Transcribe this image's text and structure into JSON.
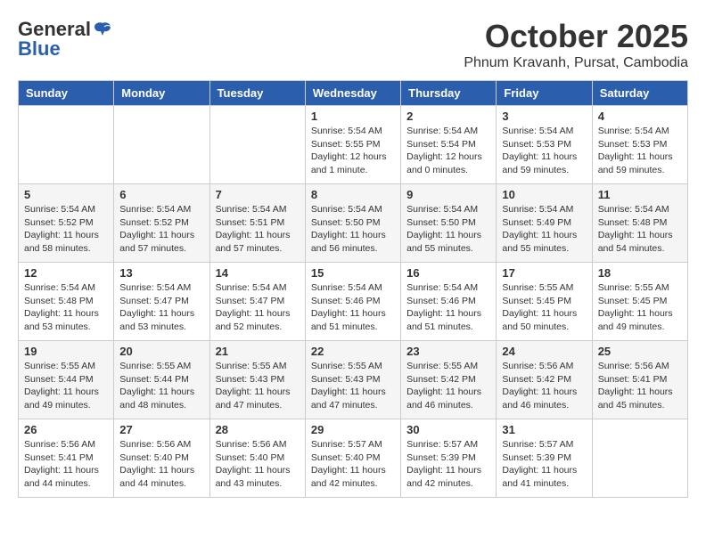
{
  "header": {
    "logo_general": "General",
    "logo_blue": "Blue",
    "month": "October 2025",
    "location": "Phnum Kravanh, Pursat, Cambodia"
  },
  "days_of_week": [
    "Sunday",
    "Monday",
    "Tuesday",
    "Wednesday",
    "Thursday",
    "Friday",
    "Saturday"
  ],
  "weeks": [
    [
      {
        "day": "",
        "info": ""
      },
      {
        "day": "",
        "info": ""
      },
      {
        "day": "",
        "info": ""
      },
      {
        "day": "1",
        "info": "Sunrise: 5:54 AM\nSunset: 5:55 PM\nDaylight: 12 hours\nand 1 minute."
      },
      {
        "day": "2",
        "info": "Sunrise: 5:54 AM\nSunset: 5:54 PM\nDaylight: 12 hours\nand 0 minutes."
      },
      {
        "day": "3",
        "info": "Sunrise: 5:54 AM\nSunset: 5:53 PM\nDaylight: 11 hours\nand 59 minutes."
      },
      {
        "day": "4",
        "info": "Sunrise: 5:54 AM\nSunset: 5:53 PM\nDaylight: 11 hours\nand 59 minutes."
      }
    ],
    [
      {
        "day": "5",
        "info": "Sunrise: 5:54 AM\nSunset: 5:52 PM\nDaylight: 11 hours\nand 58 minutes."
      },
      {
        "day": "6",
        "info": "Sunrise: 5:54 AM\nSunset: 5:52 PM\nDaylight: 11 hours\nand 57 minutes."
      },
      {
        "day": "7",
        "info": "Sunrise: 5:54 AM\nSunset: 5:51 PM\nDaylight: 11 hours\nand 57 minutes."
      },
      {
        "day": "8",
        "info": "Sunrise: 5:54 AM\nSunset: 5:50 PM\nDaylight: 11 hours\nand 56 minutes."
      },
      {
        "day": "9",
        "info": "Sunrise: 5:54 AM\nSunset: 5:50 PM\nDaylight: 11 hours\nand 55 minutes."
      },
      {
        "day": "10",
        "info": "Sunrise: 5:54 AM\nSunset: 5:49 PM\nDaylight: 11 hours\nand 55 minutes."
      },
      {
        "day": "11",
        "info": "Sunrise: 5:54 AM\nSunset: 5:48 PM\nDaylight: 11 hours\nand 54 minutes."
      }
    ],
    [
      {
        "day": "12",
        "info": "Sunrise: 5:54 AM\nSunset: 5:48 PM\nDaylight: 11 hours\nand 53 minutes."
      },
      {
        "day": "13",
        "info": "Sunrise: 5:54 AM\nSunset: 5:47 PM\nDaylight: 11 hours\nand 53 minutes."
      },
      {
        "day": "14",
        "info": "Sunrise: 5:54 AM\nSunset: 5:47 PM\nDaylight: 11 hours\nand 52 minutes."
      },
      {
        "day": "15",
        "info": "Sunrise: 5:54 AM\nSunset: 5:46 PM\nDaylight: 11 hours\nand 51 minutes."
      },
      {
        "day": "16",
        "info": "Sunrise: 5:54 AM\nSunset: 5:46 PM\nDaylight: 11 hours\nand 51 minutes."
      },
      {
        "day": "17",
        "info": "Sunrise: 5:55 AM\nSunset: 5:45 PM\nDaylight: 11 hours\nand 50 minutes."
      },
      {
        "day": "18",
        "info": "Sunrise: 5:55 AM\nSunset: 5:45 PM\nDaylight: 11 hours\nand 49 minutes."
      }
    ],
    [
      {
        "day": "19",
        "info": "Sunrise: 5:55 AM\nSunset: 5:44 PM\nDaylight: 11 hours\nand 49 minutes."
      },
      {
        "day": "20",
        "info": "Sunrise: 5:55 AM\nSunset: 5:44 PM\nDaylight: 11 hours\nand 48 minutes."
      },
      {
        "day": "21",
        "info": "Sunrise: 5:55 AM\nSunset: 5:43 PM\nDaylight: 11 hours\nand 47 minutes."
      },
      {
        "day": "22",
        "info": "Sunrise: 5:55 AM\nSunset: 5:43 PM\nDaylight: 11 hours\nand 47 minutes."
      },
      {
        "day": "23",
        "info": "Sunrise: 5:55 AM\nSunset: 5:42 PM\nDaylight: 11 hours\nand 46 minutes."
      },
      {
        "day": "24",
        "info": "Sunrise: 5:56 AM\nSunset: 5:42 PM\nDaylight: 11 hours\nand 46 minutes."
      },
      {
        "day": "25",
        "info": "Sunrise: 5:56 AM\nSunset: 5:41 PM\nDaylight: 11 hours\nand 45 minutes."
      }
    ],
    [
      {
        "day": "26",
        "info": "Sunrise: 5:56 AM\nSunset: 5:41 PM\nDaylight: 11 hours\nand 44 minutes."
      },
      {
        "day": "27",
        "info": "Sunrise: 5:56 AM\nSunset: 5:40 PM\nDaylight: 11 hours\nand 44 minutes."
      },
      {
        "day": "28",
        "info": "Sunrise: 5:56 AM\nSunset: 5:40 PM\nDaylight: 11 hours\nand 43 minutes."
      },
      {
        "day": "29",
        "info": "Sunrise: 5:57 AM\nSunset: 5:40 PM\nDaylight: 11 hours\nand 42 minutes."
      },
      {
        "day": "30",
        "info": "Sunrise: 5:57 AM\nSunset: 5:39 PM\nDaylight: 11 hours\nand 42 minutes."
      },
      {
        "day": "31",
        "info": "Sunrise: 5:57 AM\nSunset: 5:39 PM\nDaylight: 11 hours\nand 41 minutes."
      },
      {
        "day": "",
        "info": ""
      }
    ]
  ]
}
